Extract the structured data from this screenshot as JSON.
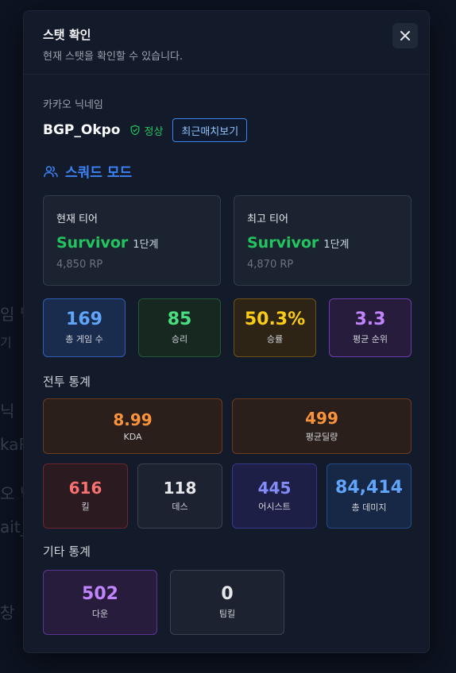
{
  "modal": {
    "title": "스탯 확인",
    "description": "현재 스탯을 확인할 수 있습니다."
  },
  "player": {
    "nickname_label": "카카오 닉네임",
    "nickname": "BGP_Okpo",
    "status": "정상",
    "recent_button": "최근매치보기"
  },
  "mode": {
    "label": "스쿼드 모드"
  },
  "tiers": {
    "current": {
      "label": "현재 티어",
      "name": "Survivor",
      "step": "1단계",
      "rp": "4,850 RP"
    },
    "best": {
      "label": "최고 티어",
      "name": "Survivor",
      "step": "1단계",
      "rp": "4,870 RP"
    }
  },
  "summary": [
    {
      "value": "169",
      "label": "총 게임 수"
    },
    {
      "value": "85",
      "label": "승리"
    },
    {
      "value": "50.3%",
      "label": "승률"
    },
    {
      "value": "3.3",
      "label": "평균 순위"
    }
  ],
  "combat": {
    "title": "전투 통계",
    "kda": {
      "value": "8.99",
      "label": "KDA"
    },
    "avg_damage": {
      "value": "499",
      "label": "평균딜량"
    },
    "kills": {
      "value": "616",
      "label": "킬"
    },
    "deaths": {
      "value": "118",
      "label": "데스"
    },
    "assists": {
      "value": "445",
      "label": "어시스트"
    },
    "total_damage": {
      "value": "84,414",
      "label": "총 데미지"
    }
  },
  "other": {
    "title": "기타 통계",
    "downs": {
      "value": "502",
      "label": "다운"
    },
    "teamkills": {
      "value": "0",
      "label": "팀킬"
    }
  },
  "background": {
    "text_1": "임 닉",
    "text_2": "기",
    "text_3": "닉",
    "text_4": "kaR",
    "text_5": "오 닉",
    "text_6": "ait_",
    "text_7": "창"
  },
  "colors": {
    "blue": "#60a5fa",
    "green": "#4ade80",
    "yellow": "#facc15",
    "purple": "#c084fc",
    "orange": "#fb923c",
    "red": "#f87171",
    "white": "#e5e7eb",
    "indigo": "#818cf8"
  },
  "icons": {
    "close": "close-icon",
    "status": "shield-check-icon",
    "mode": "users-icon"
  }
}
